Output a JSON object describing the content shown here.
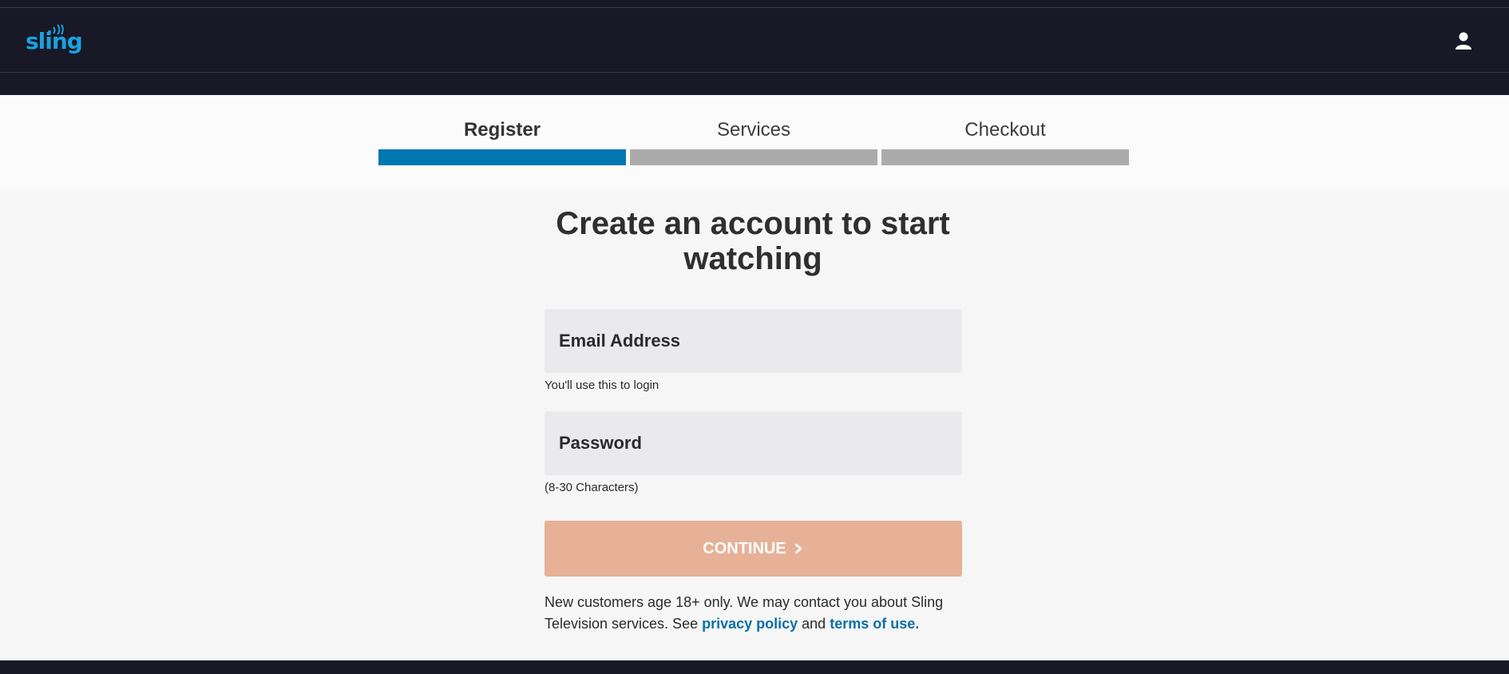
{
  "header": {
    "logo_text": "sling",
    "logo_icon": "sling-logo",
    "user_icon": "user-icon",
    "brand_color": "#1aa1e0"
  },
  "steps": [
    {
      "label": "Register",
      "active": true
    },
    {
      "label": "Services",
      "active": false
    },
    {
      "label": "Checkout",
      "active": false
    }
  ],
  "form": {
    "title": "Create an account to start watching",
    "email_label": "Email Address",
    "email_hint": "You'll use this to login",
    "password_label": "Password",
    "password_hint": "(8-30 Characters)",
    "continue_label": "CONTINUE",
    "continue_icon": "chevron-right-icon"
  },
  "disclaimer": {
    "text": "New customers age 18+ only. We may contact you about Sling Television services. See ",
    "privacy_link": "privacy policy",
    "and": " and ",
    "terms_link": "terms of use."
  },
  "colors": {
    "header_bg": "#181827",
    "active_step": "#0077b0",
    "inactive_step": "#ababab",
    "continue_disabled": "#e6b197",
    "link": "#0b6fa6"
  }
}
